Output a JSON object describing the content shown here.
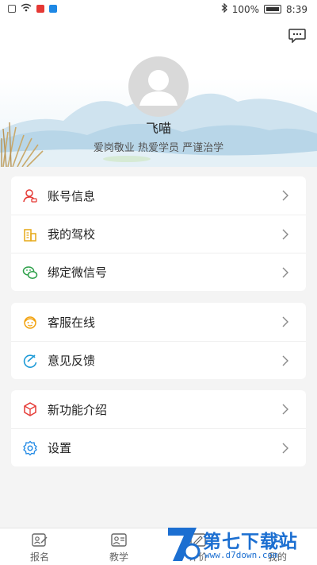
{
  "status_bar": {
    "battery": "100%",
    "time": "8:39"
  },
  "header": {
    "message_icon": "message-icon",
    "username": "飞喵",
    "motto": "爱岗敬业 热爱学员 严谨治学"
  },
  "menu_groups": [
    [
      {
        "label": "账号信息",
        "icon": "account-icon",
        "color": "#e53935"
      },
      {
        "label": "我的驾校",
        "icon": "building-icon",
        "color": "#e6a817"
      },
      {
        "label": "绑定微信号",
        "icon": "wechat-icon",
        "color": "#2ea04a"
      }
    ],
    [
      {
        "label": "客服在线",
        "icon": "customer-service-icon",
        "color": "#f2a20f"
      },
      {
        "label": "意见反馈",
        "icon": "feedback-icon",
        "color": "#1e9bd7"
      }
    ],
    [
      {
        "label": "新功能介绍",
        "icon": "new-feature-icon",
        "color": "#e53935"
      },
      {
        "label": "设置",
        "icon": "settings-icon",
        "color": "#1e88e5"
      }
    ]
  ],
  "tab_bar": [
    {
      "label": "报名",
      "icon": "enroll-icon"
    },
    {
      "label": "教学",
      "icon": "teaching-icon"
    },
    {
      "label": "评价",
      "icon": "review-icon"
    },
    {
      "label": "我的",
      "icon": "profile-icon"
    }
  ],
  "watermark": {
    "text": "第七下载站",
    "url": "www.d7down.com"
  }
}
